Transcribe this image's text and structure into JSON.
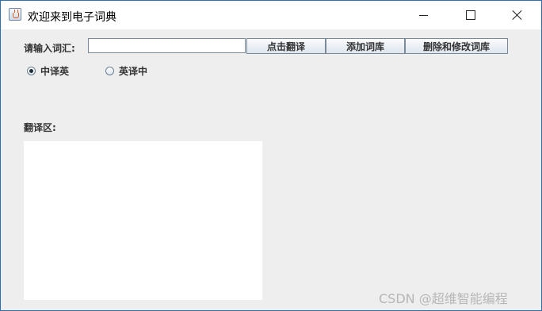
{
  "window": {
    "title": "欢迎来到电子词典",
    "icon": "java-cup-icon",
    "controls": [
      "minimize-icon",
      "maximize-icon",
      "close-icon"
    ]
  },
  "form": {
    "word_label": "请输入词汇:",
    "word_value": "",
    "buttons": {
      "translate": "点击翻译",
      "add": "添加词库",
      "edit": "删除和修改词库"
    },
    "direction": {
      "options": [
        "中译英",
        "英译中"
      ],
      "selected": "中译英"
    }
  },
  "output": {
    "label": "翻译区:",
    "text": ""
  },
  "watermark": "CSDN @超维智能编程"
}
